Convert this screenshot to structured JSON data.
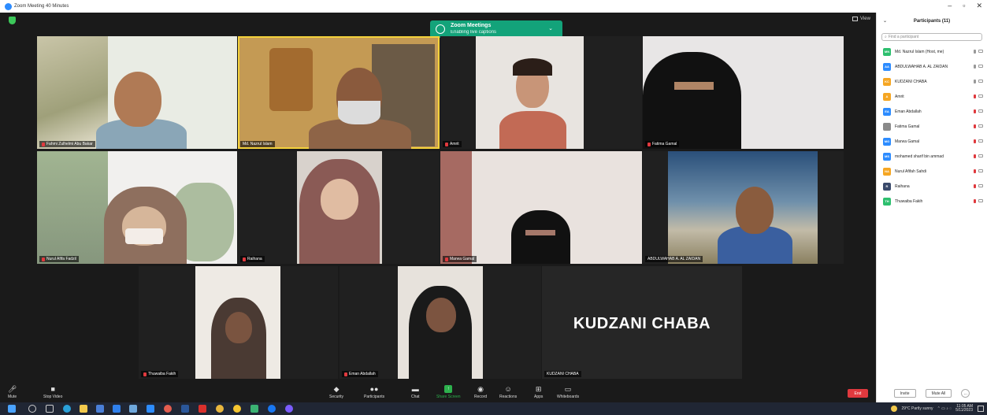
{
  "window": {
    "title": "Zoom Meeting 40 Minutes"
  },
  "toast": {
    "title": "Zoom Meetings",
    "subtitle": "Enabling live captions"
  },
  "view": {
    "label": "View"
  },
  "tiles": [
    {
      "name": "Fahmi Zulhelmi Abu Bakar",
      "muted": true
    },
    {
      "name": "Md. Nazrul Islam",
      "muted": false
    },
    {
      "name": "Amrit",
      "muted": true
    },
    {
      "name": "Fatima Gamal",
      "muted": true
    },
    {
      "name": "Nurul Afifa Fadzil",
      "muted": true
    },
    {
      "name": "Raihana",
      "muted": true
    },
    {
      "name": "Marwa Gamal",
      "muted": true
    },
    {
      "name": "ABDULWAHAB A. AL ZAIDAN",
      "muted": false
    },
    {
      "name": "Thuwaiba Fakih",
      "muted": true
    },
    {
      "name": "Eman Abdallah",
      "muted": true
    },
    {
      "name": "KUDZANI CHABA",
      "muted": false
    }
  ],
  "big_name": "KUDZANI CHABA",
  "controls": {
    "mute": "Mute",
    "stop_video": "Stop Video",
    "security": "Security",
    "participants": "Participants",
    "participants_count": "11",
    "chat": "Chat",
    "share_screen": "Share Screen",
    "record": "Record",
    "reactions": "Reactions",
    "apps": "Apps",
    "whiteboards": "Whiteboards",
    "end": "End"
  },
  "panel": {
    "title": "Participants (11)",
    "search_placeholder": "Find a participant",
    "participants": [
      {
        "initials": "MN",
        "name": "Md. Nazrul Islam (Host, me)",
        "color": "#2dbf6e",
        "mic": "on"
      },
      {
        "initials": "AA",
        "name": "ABDULWAHAB A. AL ZAIDAN",
        "color": "#2d8cff",
        "mic": "on"
      },
      {
        "initials": "KC",
        "name": "KUDZANI CHABA",
        "color": "#f5a623",
        "mic": "on"
      },
      {
        "initials": "A",
        "name": "Amrit",
        "color": "#f5a623",
        "mic": "off"
      },
      {
        "initials": "EA",
        "name": "Eman Abdallah",
        "color": "#2d8cff",
        "mic": "off"
      },
      {
        "initials": "",
        "name": "Fatima Gamal",
        "color": "#8a8a8a",
        "mic": "off"
      },
      {
        "initials": "MG",
        "name": "Marwa Gamal",
        "color": "#2d8cff",
        "mic": "off"
      },
      {
        "initials": "MS",
        "name": "mohamed sharif bin ammad",
        "color": "#2d8cff",
        "mic": "off"
      },
      {
        "initials": "NA",
        "name": "Nurul Afifah Sahdi",
        "color": "#f5a623",
        "mic": "off"
      },
      {
        "initials": "R",
        "name": "Raihana",
        "color": "#3a4a6b",
        "mic": "off"
      },
      {
        "initials": "TH",
        "name": "Thuwaiba Fakih",
        "color": "#2dbf6e",
        "mic": "off"
      }
    ],
    "invite": "Invite",
    "mute_all": "Mute All",
    "more": "..."
  },
  "taskbar": {
    "weather": "29°C Partly sunny",
    "time": "11:05 AM",
    "date": "5/11/2023"
  }
}
